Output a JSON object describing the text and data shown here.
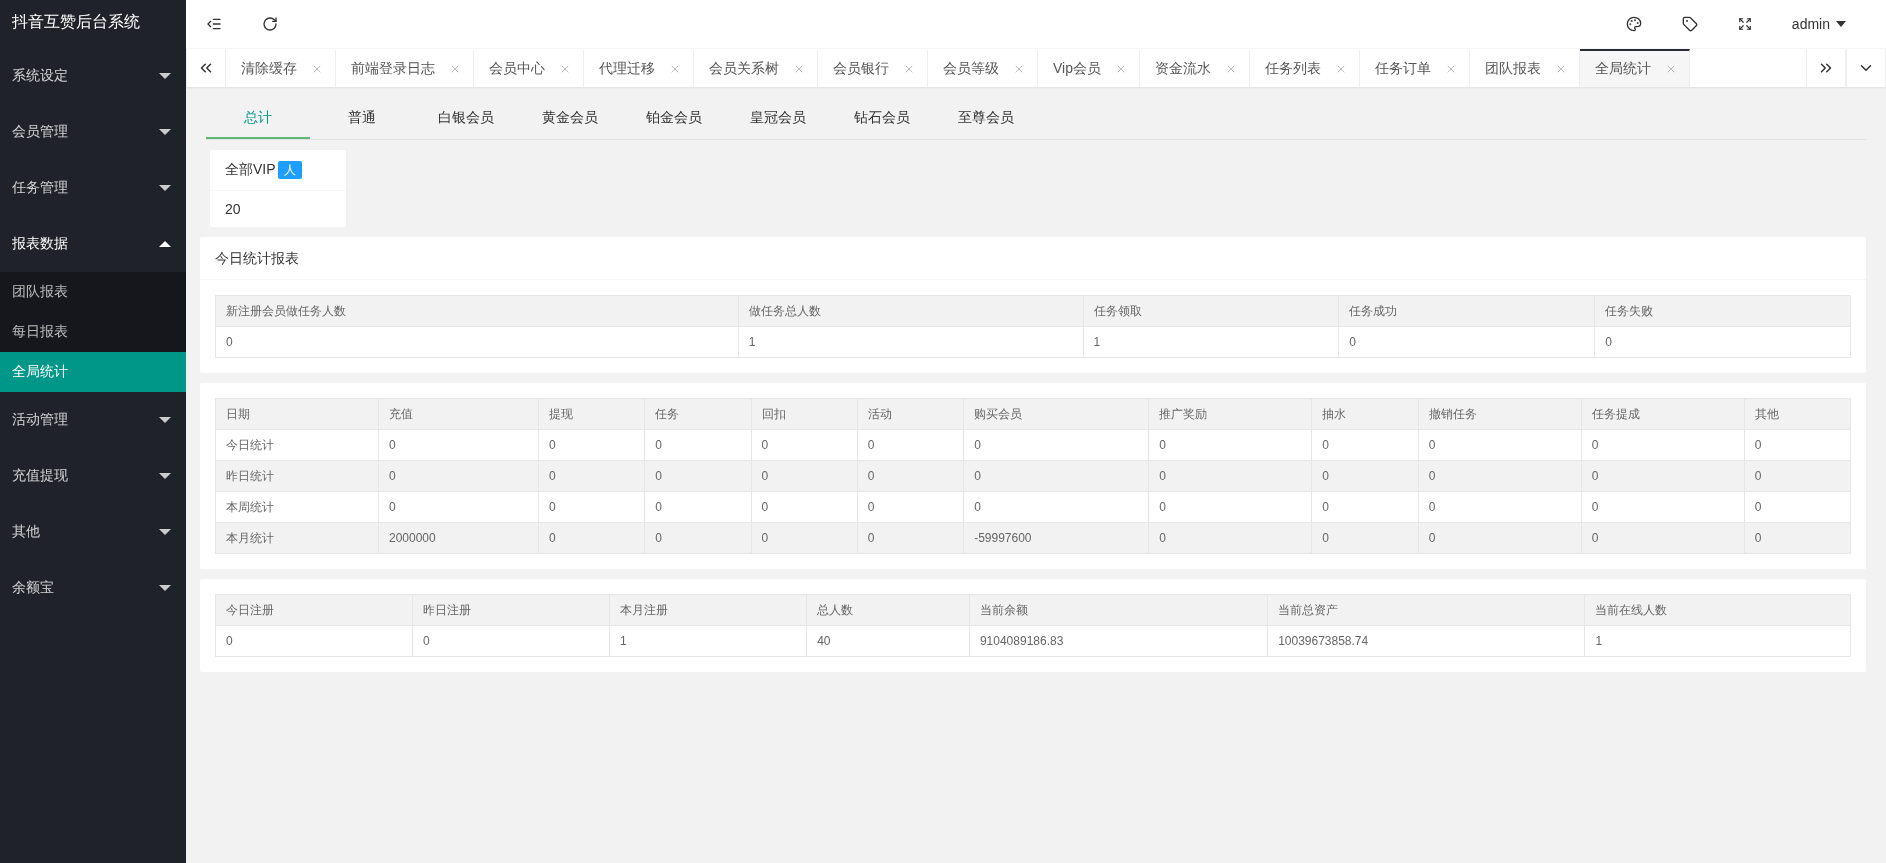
{
  "sidebar": {
    "title": "抖音互赞后台系统",
    "items": [
      {
        "label": "系统设定",
        "expanded": false
      },
      {
        "label": "会员管理",
        "expanded": false
      },
      {
        "label": "任务管理",
        "expanded": false
      },
      {
        "label": "报表数据",
        "expanded": true,
        "children": [
          {
            "label": "团队报表",
            "selected": false
          },
          {
            "label": "每日报表",
            "selected": false
          },
          {
            "label": "全局统计",
            "selected": true
          }
        ]
      },
      {
        "label": "活动管理",
        "expanded": false
      },
      {
        "label": "充值提现",
        "expanded": false
      },
      {
        "label": "其他",
        "expanded": false
      },
      {
        "label": "余额宝",
        "expanded": false
      }
    ]
  },
  "header": {
    "user": "admin"
  },
  "tabs": [
    {
      "label": "清除缓存",
      "selected": false
    },
    {
      "label": "前端登录日志",
      "selected": false
    },
    {
      "label": "会员中心",
      "selected": false
    },
    {
      "label": "代理迁移",
      "selected": false
    },
    {
      "label": "会员关系树",
      "selected": false
    },
    {
      "label": "会员银行",
      "selected": false
    },
    {
      "label": "会员等级",
      "selected": false
    },
    {
      "label": "Vip会员",
      "selected": false
    },
    {
      "label": "资金流水",
      "selected": false
    },
    {
      "label": "任务列表",
      "selected": false
    },
    {
      "label": "任务订单",
      "selected": false
    },
    {
      "label": "团队报表",
      "selected": false
    },
    {
      "label": "全局统计",
      "selected": true
    }
  ],
  "subtabs": [
    {
      "label": "总计",
      "selected": true
    },
    {
      "label": "普通",
      "selected": false
    },
    {
      "label": "白银会员",
      "selected": false
    },
    {
      "label": "黄金会员",
      "selected": false
    },
    {
      "label": "铂金会员",
      "selected": false
    },
    {
      "label": "皇冠会员",
      "selected": false
    },
    {
      "label": "钻石会员",
      "selected": false
    },
    {
      "label": "至尊会员",
      "selected": false
    }
  ],
  "vip_card": {
    "title": "全部VIP",
    "badge": "人",
    "value": "20"
  },
  "today_report": {
    "title": "今日统计报表",
    "columns": [
      "新注册会员做任务人数",
      "做任务总人数",
      "任务领取",
      "任务成功",
      "任务失败"
    ],
    "rows": [
      [
        "0",
        "1",
        "1",
        "0",
        "0"
      ]
    ]
  },
  "period_table": {
    "columns": [
      "日期",
      "充值",
      "提现",
      "任务",
      "回扣",
      "活动",
      "购买会员",
      "推广奖励",
      "抽水",
      "撤销任务",
      "任务提成",
      "其他"
    ],
    "rows": [
      [
        "今日统计",
        "0",
        "0",
        "0",
        "0",
        "0",
        "0",
        "0",
        "0",
        "0",
        "0",
        "0"
      ],
      [
        "昨日统计",
        "0",
        "0",
        "0",
        "0",
        "0",
        "0",
        "0",
        "0",
        "0",
        "0",
        "0"
      ],
      [
        "本周统计",
        "0",
        "0",
        "0",
        "0",
        "0",
        "0",
        "0",
        "0",
        "0",
        "0",
        "0"
      ],
      [
        "本月统计",
        "2000000",
        "0",
        "0",
        "0",
        "0",
        "-59997600",
        "0",
        "0",
        "0",
        "0",
        "0"
      ]
    ]
  },
  "summary_table": {
    "columns": [
      "今日注册",
      "昨日注册",
      "本月注册",
      "总人数",
      "当前余额",
      "当前总资产",
      "当前在线人数"
    ],
    "rows": [
      [
        "0",
        "0",
        "1",
        "40",
        "9104089186.83",
        "10039673858.74",
        "1"
      ]
    ]
  }
}
